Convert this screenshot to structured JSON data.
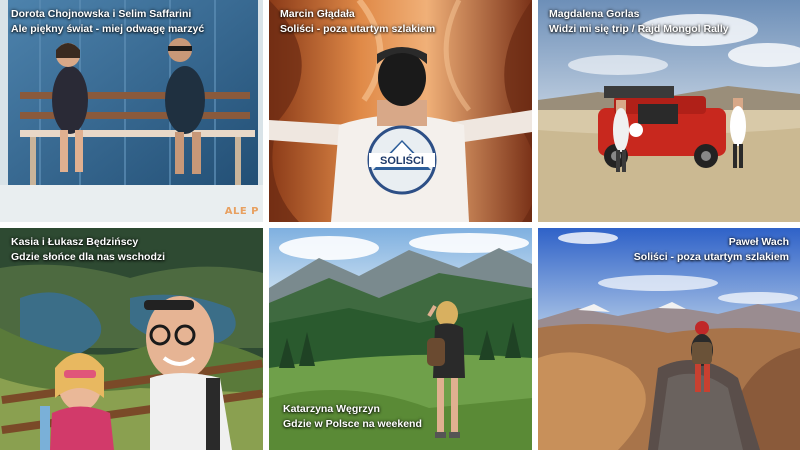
{
  "tiles": [
    {
      "author": "Dorota Chojnowska i Selim Saffarini",
      "title": "Ale piękny świat - miej odwagę marzyć",
      "watermark": "ALE P"
    },
    {
      "author": "Marcin Głądała",
      "title": "Soliści - poza utartym szlakiem",
      "shirt_text": "SOLIŚCI"
    },
    {
      "author": "Magdalena Gorlas",
      "title": "Widzi mi się trip / Rajd Mongol Rally"
    },
    {
      "author": "Kasia i Łukasz Będzińscy",
      "title": "Gdzie słońce dla nas wschodzi"
    },
    {
      "author": "Katarzyna Węgrzyn",
      "title": "Gdzie w Polsce na weekend"
    },
    {
      "author": "Paweł Wach",
      "title": "Soliści - poza utartym szlakiem"
    }
  ]
}
